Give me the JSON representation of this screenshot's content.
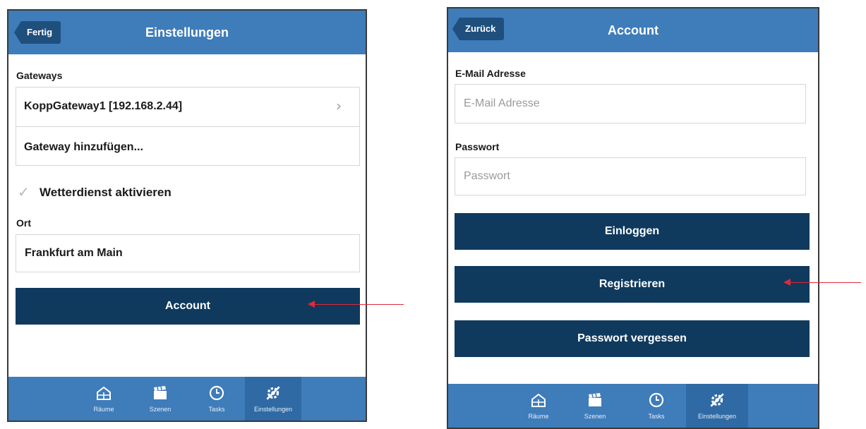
{
  "left": {
    "nav": {
      "back_label": "Fertig",
      "title": "Einstellungen"
    },
    "gateways_label": "Gateways",
    "gateways": [
      {
        "label": "KoppGateway1 [192.168.2.44]"
      },
      {
        "label": "Gateway hinzufügen..."
      }
    ],
    "weather": {
      "label": "Wetterdienst aktivieren",
      "checked": true
    },
    "ort": {
      "label": "Ort",
      "value": "Frankfurt am Main"
    },
    "account_button": "Account"
  },
  "right": {
    "nav": {
      "back_label": "Zurück",
      "title": "Account"
    },
    "email": {
      "label": "E-Mail Adresse",
      "placeholder": "E-Mail Adresse"
    },
    "password": {
      "label": "Passwort",
      "placeholder": "Passwort"
    },
    "buttons": {
      "login": "Einloggen",
      "register": "Registrieren",
      "forgot": "Passwort vergessen"
    }
  },
  "tabbar": [
    {
      "label": "Räume",
      "icon": "rooms-icon"
    },
    {
      "label": "Szenen",
      "icon": "scenes-icon"
    },
    {
      "label": "Tasks",
      "icon": "clock-icon"
    },
    {
      "label": "Einstellungen",
      "icon": "settings-icon",
      "active": true
    }
  ],
  "colors": {
    "navbar": "#3f7cba",
    "button": "#0f3a5e",
    "back_button": "#1f4f7d",
    "arrow": "#e0283a"
  }
}
